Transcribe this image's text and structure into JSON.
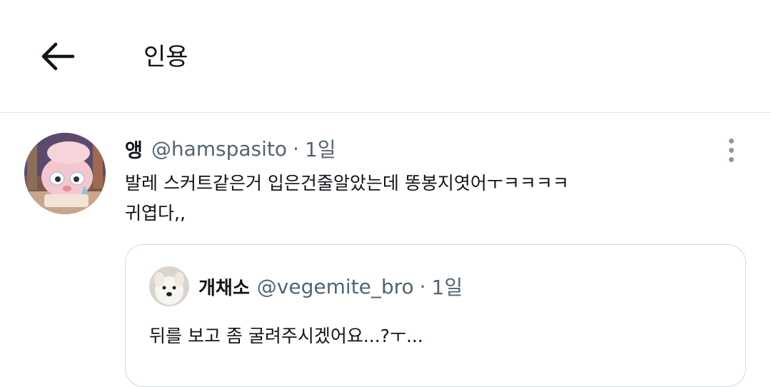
{
  "header": {
    "back_icon": "arrow-left-icon",
    "title": "인용"
  },
  "tweet": {
    "display_name": "앵",
    "handle": "@hamspasito",
    "separator": "·",
    "time": "1일",
    "text_lines": [
      "발레 스커트같은거 입은건줄알았는데 똥봉지엿어ㅜㅋㅋㅋㅋ",
      "귀엽다,,"
    ],
    "more_icon": "more-vertical-icon",
    "quoted": {
      "display_name": "개채소",
      "handle": "@vegemite_bro",
      "separator": "·",
      "time": "1일",
      "text": "뒤를 보고 좀 굴려주시겠어요...?ㅜ..."
    }
  },
  "colors": {
    "text_primary": "#0f1419",
    "text_secondary": "#536471",
    "border": "#cfd9de",
    "divider": "#e4e7ea"
  }
}
